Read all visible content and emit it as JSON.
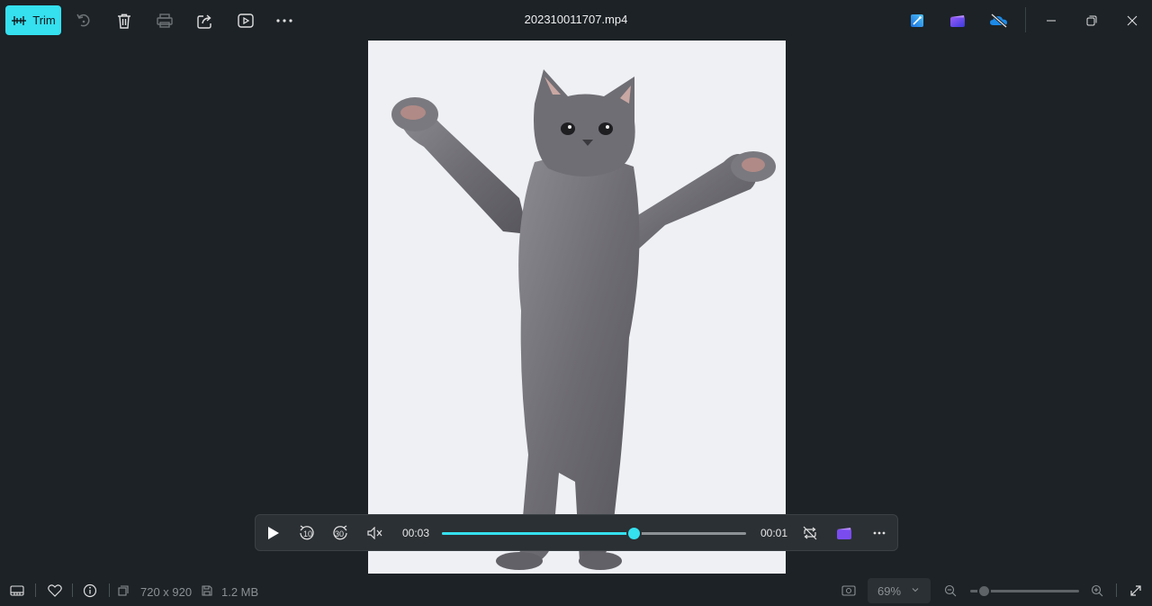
{
  "toolbar": {
    "trim_label": "Trim",
    "file_title": "202310011707.mp4",
    "icons": [
      "trim-icon",
      "rotate-icon",
      "delete-icon",
      "print-icon",
      "share-icon",
      "slideshow-icon",
      "more-icon"
    ],
    "right_icons": [
      "designer-icon",
      "clipchamp-icon",
      "onedrive-offline-icon"
    ],
    "window_controls": [
      "minimize",
      "restore",
      "close"
    ]
  },
  "player": {
    "current_time": "00:03",
    "remaining_time": "00:01",
    "progress": 0.63,
    "controls": [
      "play",
      "skip-back-10",
      "skip-forward-30",
      "mute",
      "loop",
      "clipchamp",
      "more"
    ],
    "skip_back_label": "10",
    "skip_forward_label": "30"
  },
  "status": {
    "dimensions": "720 x 920",
    "file_size": "1.2 MB",
    "zoom": "69%",
    "zoom_level": 0.12
  },
  "colors": {
    "accent": "#35e0ef",
    "background": "#1c2226",
    "panel": "#2b3034"
  }
}
